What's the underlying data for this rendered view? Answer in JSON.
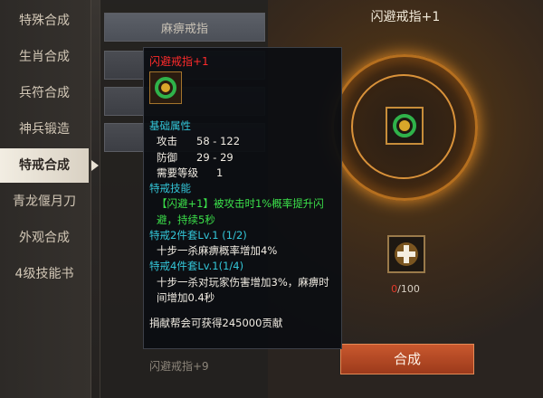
{
  "categories": [
    {
      "label": "特殊合成",
      "active": false
    },
    {
      "label": "生肖合成",
      "active": false
    },
    {
      "label": "兵符合成",
      "active": false
    },
    {
      "label": "神兵锻造",
      "active": false
    },
    {
      "label": "特戒合成",
      "active": true
    },
    {
      "label": "青龙偃月刀",
      "active": false
    },
    {
      "label": "外观合成",
      "active": false
    },
    {
      "label": "4级技能书",
      "active": false
    }
  ],
  "mid_list": {
    "header": "麻痹戒指",
    "bottom_item": "闪避戒指+9"
  },
  "craft": {
    "title": "闪避戒指+1",
    "material_have": "0",
    "material_need": "/100",
    "button": "合成"
  },
  "tooltip": {
    "name": "闪避戒指+1",
    "base_attr_title": "基础属性",
    "attack_label": "攻击",
    "attack_value": "58 - 122",
    "defense_label": "防御",
    "defense_value": "29 - 29",
    "level_label": "需要等级",
    "level_value": "1",
    "skill_title": "特戒技能",
    "skill_text": "【闪避+1】被攻击时1%概率提升闪避，持续5秒",
    "set2_title": "特戒2件套Lv.1 (1/2)",
    "set2_text": "十步一杀麻痹概率增加4%",
    "set4_title": "特戒4件套Lv.1(1/4)",
    "set4_text": "十步一杀对玩家伤害增加3%，麻痹时间增加0.4秒",
    "footer": "捐献帮会可获得245000贡献"
  },
  "colors": {
    "accent": "#c9582e",
    "tooltip_name": "#ff2b2b",
    "cyan": "#33c6d8",
    "green": "#3be04a"
  }
}
